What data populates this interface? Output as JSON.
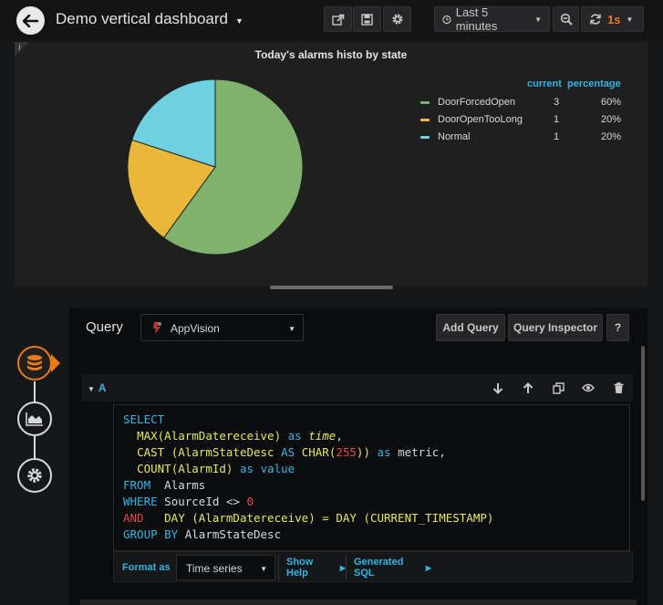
{
  "navbar": {
    "dashboard_title": "Demo vertical dashboard",
    "time_range": "Last 5 minutes",
    "refresh_interval": "1s",
    "accent_color": "#eb7b18"
  },
  "panel": {
    "title": "Today's alarms histo by state",
    "info_marker": "i",
    "legend_headers": {
      "current": "current",
      "percentage": "percentage"
    },
    "legend": [
      {
        "name": "DoorForcedOpen",
        "current": "3",
        "percentage": "60%",
        "color": "#7eb26d"
      },
      {
        "name": "DoorOpenTooLong",
        "current": "1",
        "percentage": "20%",
        "color": "#eab839"
      },
      {
        "name": "Normal",
        "current": "1",
        "percentage": "20%",
        "color": "#6ed0e0"
      }
    ]
  },
  "chart_data": {
    "type": "pie",
    "title": "Today's alarms histo by state",
    "categories": [
      "DoorForcedOpen",
      "DoorOpenTooLong",
      "Normal"
    ],
    "values": [
      3,
      1,
      1
    ],
    "colors": [
      "#7eb26d",
      "#eab839",
      "#6ed0e0"
    ],
    "legend": "right"
  },
  "query_editor": {
    "label": "Query",
    "datasource": "AppVision",
    "add_query": "Add Query",
    "query_inspector": "Query Inspector",
    "help": "?",
    "query_ref": "A",
    "sql": {
      "select": "SELECT",
      "max": "MAX",
      "max_arg": "(AlarmDatereceive)",
      "as1": "as",
      "alias_time": "time",
      "comma": ",",
      "cast": "CAST",
      "cast_open": " (AlarmStateDesc ",
      "as2": "AS",
      "char": "CHAR",
      "paren_open": "(",
      "char_len": "255",
      "cast_close": "))",
      "as3": "as",
      "alias_metric": "metric,",
      "count": "COUNT",
      "count_arg": "(AlarmId)",
      "as4": "as",
      "alias_value": "value",
      "from": "FROM",
      "table": "Alarms",
      "where": "WHERE",
      "where_cond": "SourceId <> ",
      "zero": "0",
      "and": "AND",
      "day1": "DAY",
      "day1_arg": " (AlarmDatereceive) = ",
      "day2": "DAY",
      "space": " (",
      "current_ts": "CURRENT_TIMESTAMP",
      "close": ")",
      "group_by": "GROUP BY",
      "group_col": "AlarmStateDesc"
    },
    "format_as_label": "Format as",
    "format_value": "Time series",
    "show_help": "Show Help",
    "generated_sql": "Generated SQL"
  }
}
